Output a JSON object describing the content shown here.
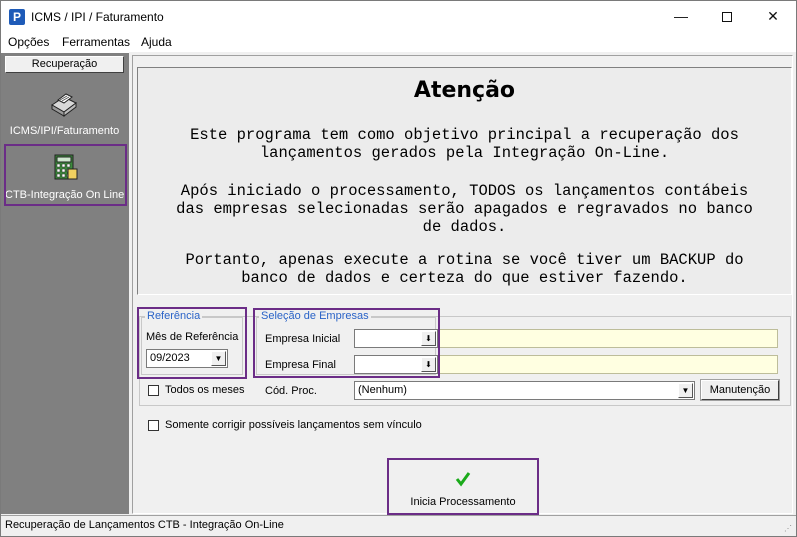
{
  "window": {
    "title": "ICMS / IPI / Faturamento",
    "icon_letter": "P",
    "minimize": "—",
    "close": "✕"
  },
  "menu": [
    "Opções",
    "Ferramentas",
    "Ajuda"
  ],
  "sidebar": {
    "header": "Recuperação",
    "items": [
      {
        "label": "ICMS/IPI/Faturamento",
        "icon": "printer-icon"
      },
      {
        "label": "CTB-Integração On Line",
        "icon": "calculator-icon"
      }
    ]
  },
  "notice": {
    "title": "Atenção",
    "paragraphs": [
      "Este programa tem como objetivo principal a recuperação dos\nlançamentos gerados pela Integração On-Line.",
      "Após iniciado o processamento, TODOS os lançamentos contábeis\ndas empresas selecionadas serão apagados e regravados no banco\nde dados.",
      "Portanto, apenas execute a rotina se você tiver um BACKUP do\nbanco de dados e certeza do que estiver fazendo."
    ]
  },
  "referencia": {
    "group_title": "Referência",
    "mes_label": "Mês de Referência",
    "mes_value": "09/2023",
    "todos_label": "Todos os meses"
  },
  "empresas": {
    "group_title": "Seleção de Empresas",
    "inicial_label": "Empresa Inicial",
    "final_label": "Empresa Final",
    "inicial_value": "",
    "final_value": "",
    "cod_proc_label": "Cód. Proc.",
    "cod_proc_value": "(Nenhum)",
    "manutencao_label": "Manutenção"
  },
  "somente_label": "Somente corrigir possíveis lançamentos sem vínculo",
  "start_button": {
    "label": "Inicia Processamento",
    "icon": "checkmark-icon"
  },
  "status": "Recuperação de Lançamentos CTB - Integração On-Line",
  "colors": {
    "highlight": "#6b2d87",
    "group_title": "#2a63c7",
    "field_yellow": "#ffffe1",
    "check_green": "#1aaa1a"
  }
}
